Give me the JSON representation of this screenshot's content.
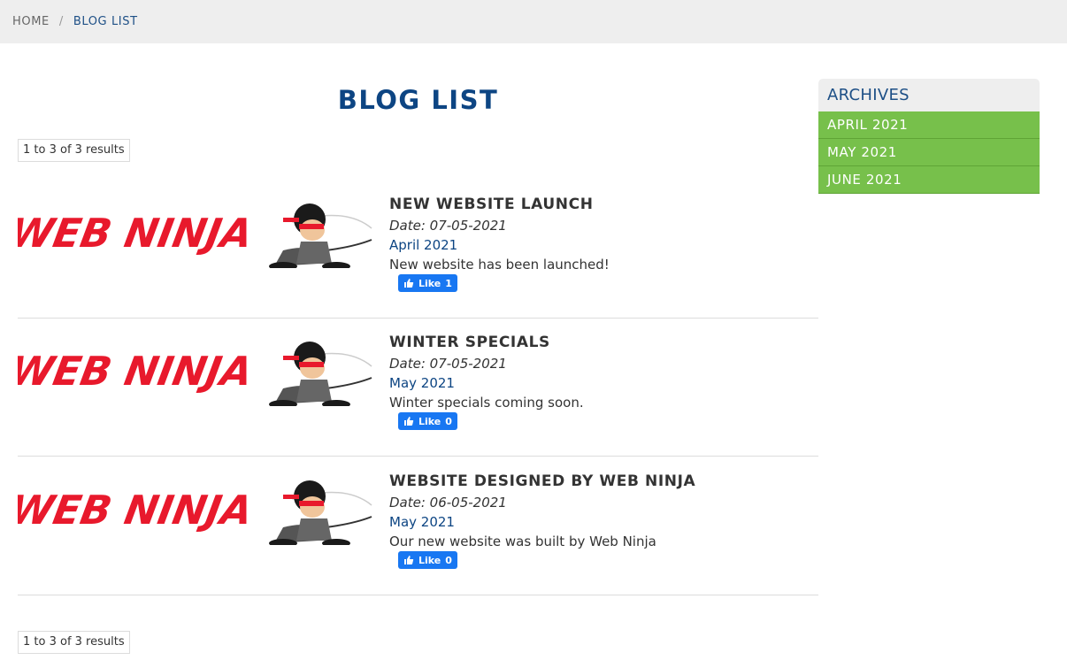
{
  "breadcrumb": {
    "home": "HOME",
    "separator": "/",
    "current": "BLOG LIST"
  },
  "page_title": "BLOG LIST",
  "results_top": "1 to 3 of 3 results",
  "results_bottom": "1 to 3 of 3 results",
  "logo_text": "WEB NINJA",
  "posts": [
    {
      "title": "NEW WEBSITE LAUNCH",
      "date": "Date: 07-05-2021",
      "month": "April 2021",
      "summary": "New website has been launched!",
      "like_label": "Like",
      "like_count": "1"
    },
    {
      "title": "WINTER SPECIALS",
      "date": "Date: 07-05-2021",
      "month": "May 2021",
      "summary": "Winter specials coming soon.",
      "like_label": "Like",
      "like_count": "0"
    },
    {
      "title": "WEBSITE DESIGNED BY WEB NINJA",
      "date": "Date: 06-05-2021",
      "month": "May 2021",
      "summary": "Our new website was built by Web Ninja",
      "like_label": "Like",
      "like_count": "0"
    }
  ],
  "archives": {
    "heading": "ARCHIVES",
    "items": [
      "APRIL 2021",
      "MAY 2021",
      "JUNE 2021"
    ]
  },
  "colors": {
    "brand_blue": "#0d4583",
    "archive_green": "#77c04b",
    "logo_red": "#e8192c",
    "facebook_blue": "#1877f2"
  },
  "icons": {
    "like": "thumbs-up-icon",
    "logo": "web-ninja-logo"
  }
}
